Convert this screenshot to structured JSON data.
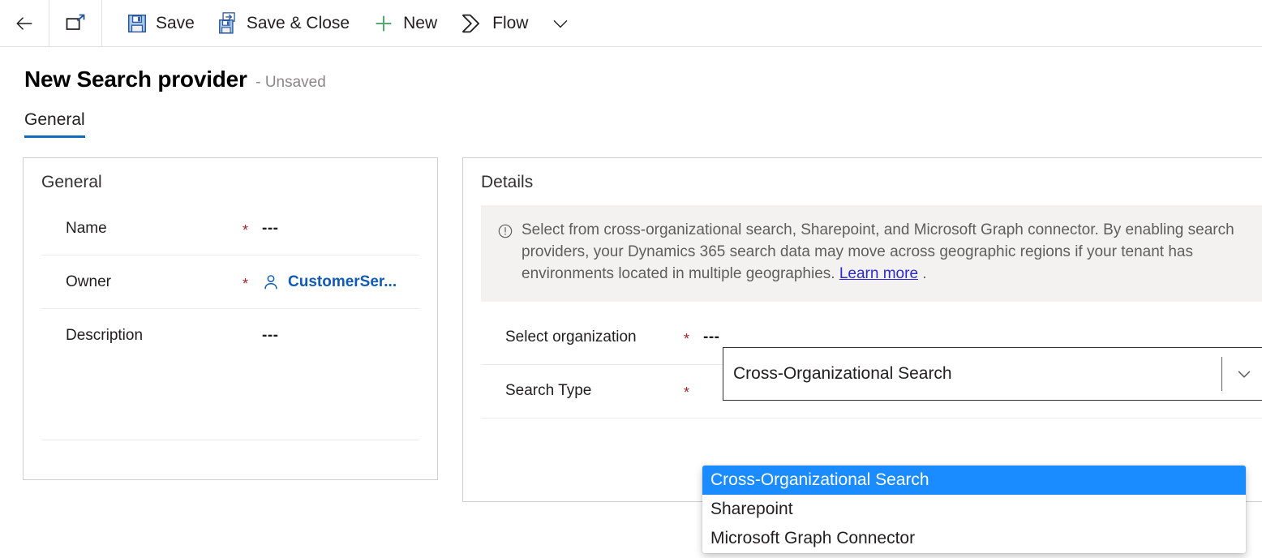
{
  "commandbar": {
    "back": {
      "name": "Back",
      "icon": "arrow-left-icon"
    },
    "popout": {
      "name": "Open in new window",
      "icon": "popout-icon"
    },
    "buttons": [
      {
        "label": "Save",
        "icon": "save-icon"
      },
      {
        "label": "Save & Close",
        "icon": "save-and-close-icon"
      },
      {
        "label": "New",
        "icon": "plus-icon"
      },
      {
        "label": "Flow",
        "icon": "flow-icon"
      }
    ],
    "overflow": {
      "label": "",
      "icon": "chevron-down-icon"
    }
  },
  "header": {
    "title": "New Search provider",
    "subtitle": "- Unsaved"
  },
  "tabs": [
    {
      "label": "General",
      "active": true
    }
  ],
  "general_card": {
    "title": "General",
    "fields": [
      {
        "label": "Name",
        "required": "*",
        "value": "---",
        "type": "text"
      },
      {
        "label": "Owner",
        "required": "*",
        "value": "CustomerSer...",
        "type": "lookup",
        "icon": "person-icon"
      },
      {
        "label": "Description",
        "required": "",
        "value": "---",
        "type": "text"
      }
    ]
  },
  "details_card": {
    "title": "Details",
    "banner": {
      "icon": "info-circle-icon",
      "text_before_link": "Select from cross-organizational search, Sharepoint, and Microsoft Graph connector. By enabling search providers, your Dynamics 365 search data may move across geographic regions if your tenant has environments located in multiple geographies. ",
      "link_text": "Learn more",
      "text_after_link": " ."
    },
    "fields": [
      {
        "label": "Select organization",
        "required": "*",
        "value": "---"
      },
      {
        "label": "Search Type",
        "required": "*",
        "value": ""
      }
    ],
    "search_type_combo": {
      "value": "Cross-Organizational Search",
      "expand_icon": "chevron-down-icon",
      "options": [
        {
          "label": "Cross-Organizational Search",
          "selected": true
        },
        {
          "label": "Sharepoint",
          "selected": false
        },
        {
          "label": "Microsoft Graph Connector",
          "selected": false
        }
      ]
    }
  },
  "colors": {
    "accent": "#0f6cbd",
    "required": "#a4262c",
    "link": "#2b2bd1",
    "lookup_link": "#0f5bb5",
    "highlight": "#1a8cff",
    "banner_bg": "#f3f2f1",
    "border": "#d2d0ce"
  }
}
